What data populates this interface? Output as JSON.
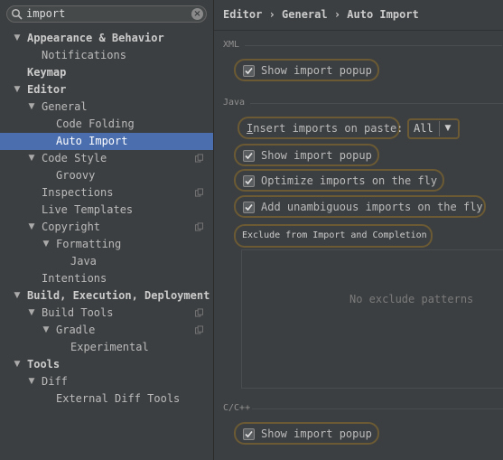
{
  "search": {
    "value": "import"
  },
  "tree": [
    {
      "label": "Appearance & Behavior",
      "level": 0,
      "arrow": "down",
      "bold": true
    },
    {
      "label": "Notifications",
      "level": 1
    },
    {
      "label": "Keymap",
      "level": 0,
      "bold": true
    },
    {
      "label": "Editor",
      "level": 0,
      "arrow": "down",
      "bold": true
    },
    {
      "label": "General",
      "level": 1,
      "arrow": "down"
    },
    {
      "label": "Code Folding",
      "level": 2
    },
    {
      "label": "Auto Import",
      "level": 2,
      "selected": true
    },
    {
      "label": "Code Style",
      "level": 1,
      "arrow": "down",
      "copy": true
    },
    {
      "label": "Groovy",
      "level": 2
    },
    {
      "label": "Inspections",
      "level": 1,
      "copy": true
    },
    {
      "label": "Live Templates",
      "level": 1
    },
    {
      "label": "Copyright",
      "level": 1,
      "arrow": "down",
      "copy": true
    },
    {
      "label": "Formatting",
      "level": 2,
      "arrow": "down"
    },
    {
      "label": "Java",
      "level": 3
    },
    {
      "label": "Intentions",
      "level": 1
    },
    {
      "label": "Build, Execution, Deployment",
      "level": 0,
      "arrow": "down",
      "bold": true
    },
    {
      "label": "Build Tools",
      "level": 1,
      "arrow": "down",
      "copy": true
    },
    {
      "label": "Gradle",
      "level": 2,
      "arrow": "down",
      "copy": true
    },
    {
      "label": "Experimental",
      "level": 3
    },
    {
      "label": "Tools",
      "level": 0,
      "arrow": "down",
      "bold": true
    },
    {
      "label": "Diff",
      "level": 1,
      "arrow": "down"
    },
    {
      "label": "External Diff Tools",
      "level": 2
    }
  ],
  "breadcrumb": "Editor › General › Auto Import",
  "sections": {
    "xml": "XML",
    "java": "Java",
    "cpp": "C/C++"
  },
  "xml": {
    "show_popup": {
      "label": "Show import popup",
      "checked": true
    }
  },
  "java": {
    "insert_imports": {
      "label": "Insert imports on paste:",
      "value": "All"
    },
    "show_popup": {
      "label": "Show import popup",
      "checked": true
    },
    "optimize": {
      "label": "Optimize imports on the fly",
      "checked": true
    },
    "unambiguous": {
      "label": "Add unambiguous imports on the fly",
      "checked": true
    },
    "exclude_button": "Exclude from Import and Completion",
    "exclude_empty": "No exclude patterns"
  },
  "cpp": {
    "show_popup": {
      "label": "Show import popup",
      "checked": true
    }
  },
  "colors": {
    "selection": "#4b6eaf",
    "highlight": "#6b5a34",
    "background": "#3c3f41"
  }
}
